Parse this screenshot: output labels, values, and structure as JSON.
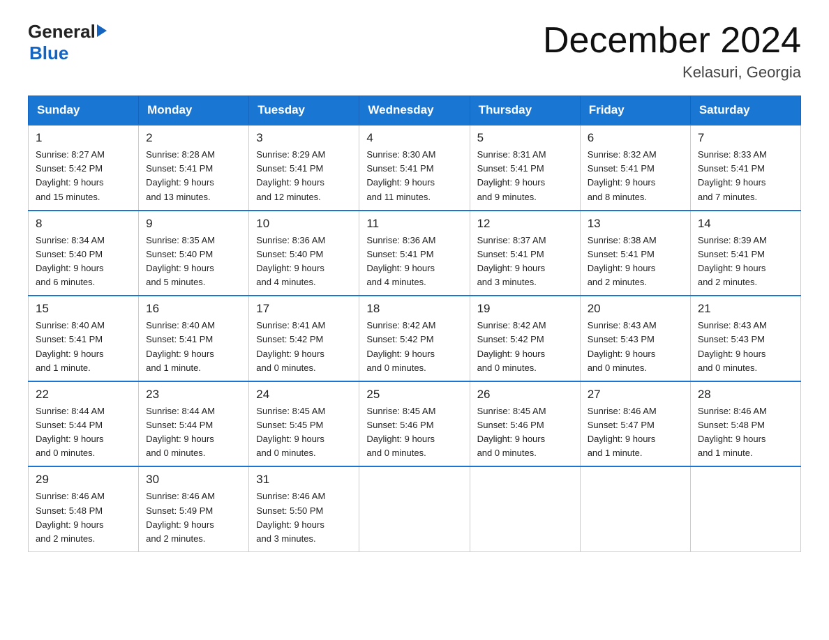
{
  "header": {
    "logo_general": "General",
    "logo_blue": "Blue",
    "month": "December 2024",
    "location": "Kelasuri, Georgia"
  },
  "days_of_week": [
    "Sunday",
    "Monday",
    "Tuesday",
    "Wednesday",
    "Thursday",
    "Friday",
    "Saturday"
  ],
  "weeks": [
    [
      {
        "day": "1",
        "sunrise": "8:27 AM",
        "sunset": "5:42 PM",
        "daylight": "9 hours and 15 minutes."
      },
      {
        "day": "2",
        "sunrise": "8:28 AM",
        "sunset": "5:41 PM",
        "daylight": "9 hours and 13 minutes."
      },
      {
        "day": "3",
        "sunrise": "8:29 AM",
        "sunset": "5:41 PM",
        "daylight": "9 hours and 12 minutes."
      },
      {
        "day": "4",
        "sunrise": "8:30 AM",
        "sunset": "5:41 PM",
        "daylight": "9 hours and 11 minutes."
      },
      {
        "day": "5",
        "sunrise": "8:31 AM",
        "sunset": "5:41 PM",
        "daylight": "9 hours and 9 minutes."
      },
      {
        "day": "6",
        "sunrise": "8:32 AM",
        "sunset": "5:41 PM",
        "daylight": "9 hours and 8 minutes."
      },
      {
        "day": "7",
        "sunrise": "8:33 AM",
        "sunset": "5:41 PM",
        "daylight": "9 hours and 7 minutes."
      }
    ],
    [
      {
        "day": "8",
        "sunrise": "8:34 AM",
        "sunset": "5:40 PM",
        "daylight": "9 hours and 6 minutes."
      },
      {
        "day": "9",
        "sunrise": "8:35 AM",
        "sunset": "5:40 PM",
        "daylight": "9 hours and 5 minutes."
      },
      {
        "day": "10",
        "sunrise": "8:36 AM",
        "sunset": "5:40 PM",
        "daylight": "9 hours and 4 minutes."
      },
      {
        "day": "11",
        "sunrise": "8:36 AM",
        "sunset": "5:41 PM",
        "daylight": "9 hours and 4 minutes."
      },
      {
        "day": "12",
        "sunrise": "8:37 AM",
        "sunset": "5:41 PM",
        "daylight": "9 hours and 3 minutes."
      },
      {
        "day": "13",
        "sunrise": "8:38 AM",
        "sunset": "5:41 PM",
        "daylight": "9 hours and 2 minutes."
      },
      {
        "day": "14",
        "sunrise": "8:39 AM",
        "sunset": "5:41 PM",
        "daylight": "9 hours and 2 minutes."
      }
    ],
    [
      {
        "day": "15",
        "sunrise": "8:40 AM",
        "sunset": "5:41 PM",
        "daylight": "9 hours and 1 minute."
      },
      {
        "day": "16",
        "sunrise": "8:40 AM",
        "sunset": "5:41 PM",
        "daylight": "9 hours and 1 minute."
      },
      {
        "day": "17",
        "sunrise": "8:41 AM",
        "sunset": "5:42 PM",
        "daylight": "9 hours and 0 minutes."
      },
      {
        "day": "18",
        "sunrise": "8:42 AM",
        "sunset": "5:42 PM",
        "daylight": "9 hours and 0 minutes."
      },
      {
        "day": "19",
        "sunrise": "8:42 AM",
        "sunset": "5:42 PM",
        "daylight": "9 hours and 0 minutes."
      },
      {
        "day": "20",
        "sunrise": "8:43 AM",
        "sunset": "5:43 PM",
        "daylight": "9 hours and 0 minutes."
      },
      {
        "day": "21",
        "sunrise": "8:43 AM",
        "sunset": "5:43 PM",
        "daylight": "9 hours and 0 minutes."
      }
    ],
    [
      {
        "day": "22",
        "sunrise": "8:44 AM",
        "sunset": "5:44 PM",
        "daylight": "9 hours and 0 minutes."
      },
      {
        "day": "23",
        "sunrise": "8:44 AM",
        "sunset": "5:44 PM",
        "daylight": "9 hours and 0 minutes."
      },
      {
        "day": "24",
        "sunrise": "8:45 AM",
        "sunset": "5:45 PM",
        "daylight": "9 hours and 0 minutes."
      },
      {
        "day": "25",
        "sunrise": "8:45 AM",
        "sunset": "5:46 PM",
        "daylight": "9 hours and 0 minutes."
      },
      {
        "day": "26",
        "sunrise": "8:45 AM",
        "sunset": "5:46 PM",
        "daylight": "9 hours and 0 minutes."
      },
      {
        "day": "27",
        "sunrise": "8:46 AM",
        "sunset": "5:47 PM",
        "daylight": "9 hours and 1 minute."
      },
      {
        "day": "28",
        "sunrise": "8:46 AM",
        "sunset": "5:48 PM",
        "daylight": "9 hours and 1 minute."
      }
    ],
    [
      {
        "day": "29",
        "sunrise": "8:46 AM",
        "sunset": "5:48 PM",
        "daylight": "9 hours and 2 minutes."
      },
      {
        "day": "30",
        "sunrise": "8:46 AM",
        "sunset": "5:49 PM",
        "daylight": "9 hours and 2 minutes."
      },
      {
        "day": "31",
        "sunrise": "8:46 AM",
        "sunset": "5:50 PM",
        "daylight": "9 hours and 3 minutes."
      },
      null,
      null,
      null,
      null
    ]
  ],
  "labels": {
    "sunrise": "Sunrise:",
    "sunset": "Sunset:",
    "daylight": "Daylight:"
  }
}
